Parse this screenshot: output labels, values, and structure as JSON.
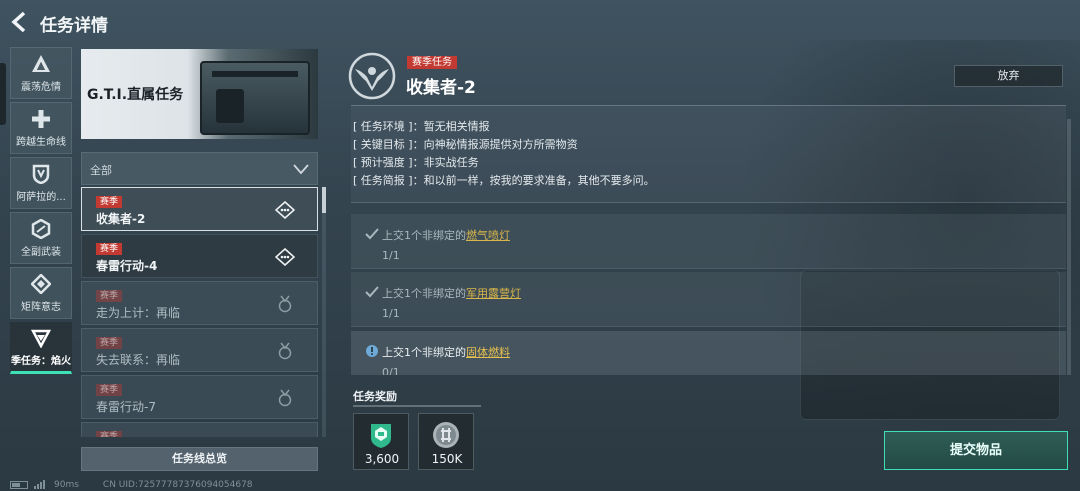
{
  "header": {
    "title": "任务详情"
  },
  "sidebar": {
    "items": [
      {
        "label": "震荡危情",
        "icon": "triangle-a-icon"
      },
      {
        "label": "跨越生命线",
        "icon": "cross-icon"
      },
      {
        "label": "阿萨拉的...",
        "icon": "shield-icon"
      },
      {
        "label": "全副武装",
        "icon": "hexagon-icon"
      },
      {
        "label": "矩阵意志",
        "icon": "diamond-icon"
      },
      {
        "label": "季任务：焰火",
        "icon": "chevron-down-emblem-icon",
        "active": true
      }
    ]
  },
  "banner": {
    "title": "G.T.I.直属任务"
  },
  "filter": {
    "label": "全部"
  },
  "quests": [
    {
      "tag": "赛季",
      "name": "收集者-2",
      "state": "selected"
    },
    {
      "tag": "赛季",
      "name": "春雷行动-4",
      "state": "active"
    },
    {
      "tag": "赛季",
      "name": "走为上计：再临",
      "state": "locked"
    },
    {
      "tag": "赛季",
      "name": "失去联系：再临",
      "state": "locked"
    },
    {
      "tag": "赛季",
      "name": "春雷行动-7",
      "state": "locked"
    },
    {
      "tag": "赛季",
      "name": "",
      "state": "locked"
    }
  ],
  "overview_button": "任务线总览",
  "status": {
    "ping": "90ms",
    "uid": "CN UID:7257778737609405467​8"
  },
  "detail": {
    "tag": "赛季任务",
    "title": "收集者-2",
    "abandon_label": "放弃",
    "info": [
      {
        "key": "[ 任务环境 ]",
        "value": "暂无相关情报"
      },
      {
        "key": "[ 关键目标 ]",
        "value": "向神秘情报源提供对方所需物资"
      },
      {
        "key": "[ 预计强度 ]",
        "value": "非实战任务"
      },
      {
        "key": "[ 任务简报 ]",
        "value": "和以前一样，按我的要求准备，其他不要多问。"
      }
    ],
    "objectives": [
      {
        "prefix": "上交1个非绑定的",
        "item": "燃气喷灯",
        "progress": "1/1",
        "done": true
      },
      {
        "prefix": "上交1个非绑定的",
        "item": "军用露营灯",
        "progress": "1/1",
        "done": true
      },
      {
        "prefix": "上交1个非绑定的",
        "item": "固体燃料",
        "progress": "0/1",
        "done": false
      }
    ]
  },
  "rewards": {
    "title": "任务奖励",
    "items": [
      {
        "icon": "green-badge-icon",
        "amount": "3,600"
      },
      {
        "icon": "silver-coin-icon",
        "amount": "150K"
      }
    ]
  },
  "submit_label": "提交物品",
  "colors": {
    "accent": "#3ee0b5",
    "tag_red": "#c23a32",
    "item_gold": "#d9b64a"
  }
}
